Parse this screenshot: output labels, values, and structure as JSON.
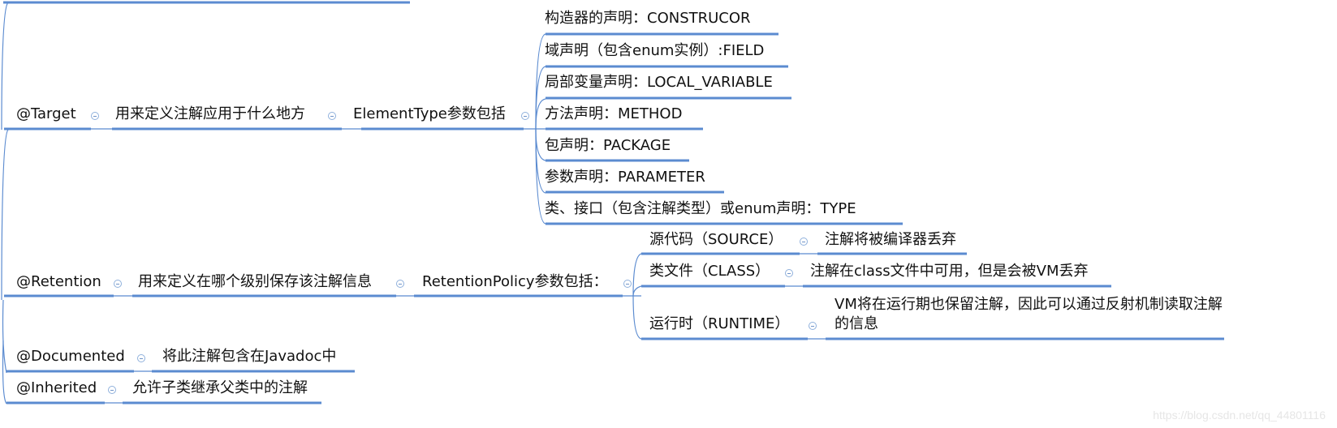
{
  "diagram": {
    "type": "mind-map",
    "line_color": "#5b8bd0",
    "roots": [
      {
        "label": "@Target",
        "description": "用来定义注解应用于什么地方",
        "sub": {
          "label": "ElementType参数包括",
          "children": [
            "构造器的声明：CONSTRUCOR",
            "域声明（包含enum实例）:FIELD",
            "局部变量声明：LOCAL_VARIABLE",
            "方法声明：METHOD",
            "包声明：PACKAGE",
            "参数声明：PARAMETER",
            "类、接口（包含注解类型）或enum声明：TYPE"
          ]
        }
      },
      {
        "label": "@Retention",
        "description": "用来定义在哪个级别保存该注解信息",
        "sub": {
          "label": "RetentionPolicy参数包括：",
          "children": [
            {
              "label": "源代码（SOURCE）",
              "detail": "注解将被编译器丢弃"
            },
            {
              "label": "类文件（CLASS）",
              "detail": "注解在class文件中可用，但是会被VM丢弃"
            },
            {
              "label": "运行时（RUNTIME）",
              "detail": "VM将在运行期也保留注解，因此可以通过反射机制读取注解的信息"
            }
          ]
        }
      },
      {
        "label": "@Documented",
        "description": "将此注解包含在Javadoc中"
      },
      {
        "label": "@Inherited",
        "description": "允许子类继承父类中的注解"
      }
    ]
  },
  "watermark": "https://blog.csdn.net/qq_44801116"
}
